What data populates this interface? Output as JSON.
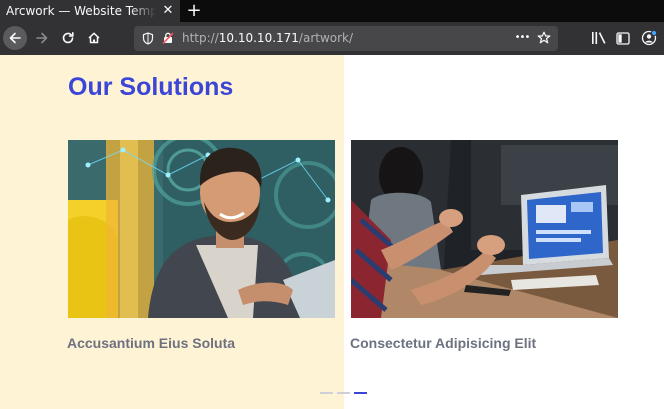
{
  "browser": {
    "tab": {
      "title": "Arcwork — Website Template",
      "close_glyph": "✕"
    },
    "new_tab_glyph": "+",
    "url": {
      "scheme": "http://",
      "host": "10.10.10.171",
      "path": "/artwork/"
    },
    "page_actions_glyph": "•••",
    "icons": [
      "back-arrow-icon",
      "forward-arrow-icon",
      "reload-icon",
      "home-icon",
      "shield-icon",
      "insecure-lock-icon",
      "star-icon",
      "library-icon",
      "sidebar-icon",
      "account-icon"
    ]
  },
  "page": {
    "heading": "Our Solutions",
    "cards": [
      {
        "title": "Accusantium Eius Soluta"
      },
      {
        "title": "Consectetur Adipisicing Elit"
      }
    ],
    "slider": {
      "count": 3,
      "active_index": 2
    }
  },
  "colors": {
    "accent": "#3b46d6",
    "panel": "#fff3d6",
    "card_title": "#6d7180",
    "browser_chrome": "#323234"
  }
}
